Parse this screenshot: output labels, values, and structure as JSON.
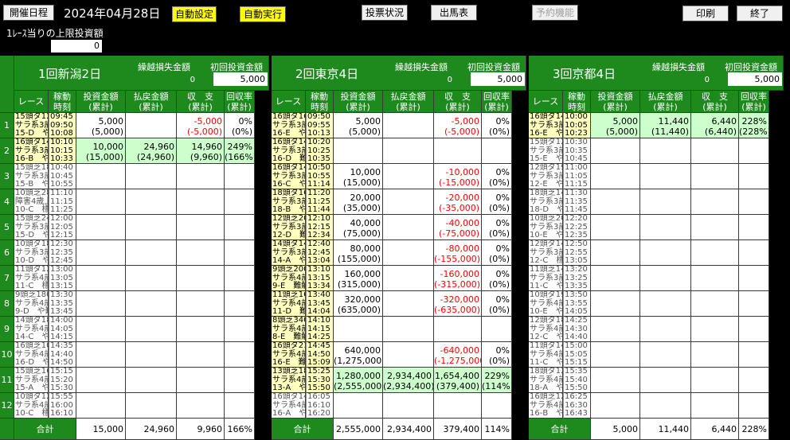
{
  "toolbar": {
    "schedule": "開催日程",
    "date": "2024年04月28日",
    "auto_setting": "自動設定",
    "auto_run": "自動実行",
    "vote_status": "投票状況",
    "entries": "出馬表",
    "reservation": "予約機能",
    "print": "印刷",
    "exit": "終了"
  },
  "limit": {
    "label": "1ﾚｰｽ当りの上限投資額",
    "value": "0"
  },
  "headers": {
    "race": "レース",
    "time": "稼動\n時刻",
    "invest": "投資金額\n(累計)",
    "payout": "払戻金額\n(累計)",
    "balance": "収　支\n(累計)",
    "rate": "回収率\n(累計)",
    "carry_label": "繰越損失金額",
    "first_label": "初回投資金額",
    "total": "合計"
  },
  "venues": [
    {
      "name": "1回新潟2日",
      "carry": "0",
      "first": "5,000",
      "rows": [
        {
          "race": "15頭ダ1200\nサラ系3歳\n15-D　や難",
          "time": "09:45\n09:50\n10:08",
          "hl": true,
          "dim": false,
          "invest": [
            "5,000",
            "(5,000)"
          ],
          "payout": [
            "",
            ""
          ],
          "balance": [
            "-5,000",
            "(-5,000)"
          ],
          "rate": [
            "0%",
            "(0%)"
          ],
          "green": false
        },
        {
          "race": "16頭ダ1400\nサラ系3歳\n16-B　や難",
          "time": "10:10\n10:15\n10:33",
          "hl": true,
          "dim": false,
          "invest": [
            "10,000",
            "(15,000)"
          ],
          "payout": [
            "24,960",
            "(24,960)"
          ],
          "balance": [
            "14,960",
            "(9,960)"
          ],
          "rate": [
            "249%",
            "(166%)"
          ],
          "green": true
        },
        {
          "race": "15頭芝1800\nサラ系3歳\n15-B　や難",
          "time": "10:40\n10:45\n10:55",
          "hl": false,
          "dim": true,
          "invest": [
            "",
            ""
          ],
          "payout": [
            "",
            ""
          ],
          "balance": [
            "",
            ""
          ],
          "rate": [
            "",
            ""
          ],
          "green": false
        },
        {
          "race": "10頭芝2890\n障害4歳上\n10-C　標準",
          "time": "11:10\n11:15\n11:25",
          "hl": false,
          "dim": true,
          "invest": [
            "",
            ""
          ],
          "payout": [
            "",
            ""
          ],
          "balance": [
            "",
            ""
          ],
          "rate": [
            "",
            ""
          ],
          "green": false
        },
        {
          "race": "15頭芝2400\nサラ系3歳\n15-D　や難",
          "time": "12:00\n12:05\n12:15",
          "hl": false,
          "dim": true,
          "invest": [
            "",
            ""
          ],
          "payout": [
            "",
            ""
          ],
          "balance": [
            "",
            ""
          ],
          "rate": [
            "",
            ""
          ],
          "green": false
        },
        {
          "race": "10頭ダ1800\nサラ系3歳\n10-D　や難",
          "time": "12:30\n12:35\n12:45",
          "hl": false,
          "dim": true,
          "invest": [
            "",
            ""
          ],
          "payout": [
            "",
            ""
          ],
          "balance": [
            "",
            ""
          ],
          "rate": [
            "",
            ""
          ],
          "green": false
        },
        {
          "race": "11頭ダ1200\nサラ系4歳上\n11-C　標準",
          "time": "13:00\n13:05\n13:15",
          "hl": false,
          "dim": true,
          "invest": [
            "",
            ""
          ],
          "payout": [
            "",
            ""
          ],
          "balance": [
            "",
            ""
          ],
          "rate": [
            "",
            ""
          ],
          "green": false
        },
        {
          "race": "9頭芝1800\nサラ系4歳上\n9-D　や難",
          "time": "13:30\n13:35\n13:45",
          "hl": false,
          "dim": true,
          "invest": [
            "",
            ""
          ],
          "payout": [
            "",
            ""
          ],
          "balance": [
            "",
            ""
          ],
          "rate": [
            "",
            ""
          ],
          "green": false
        },
        {
          "race": "14頭ダ1800\nサラ系4歳上\n14-C　や難",
          "time": "14:00\n14:05\n14:15",
          "hl": false,
          "dim": true,
          "invest": [
            "",
            ""
          ],
          "payout": [
            "",
            ""
          ],
          "balance": [
            "",
            ""
          ],
          "rate": [
            "",
            ""
          ],
          "green": false
        },
        {
          "race": "16頭芝1000\nサラ系4歳上\n16-D　や難",
          "time": "14:35\n14:40\n14:50",
          "hl": false,
          "dim": true,
          "invest": [
            "",
            ""
          ],
          "payout": [
            "",
            ""
          ],
          "balance": [
            "",
            ""
          ],
          "rate": [
            "",
            ""
          ],
          "green": false
        },
        {
          "race": "15頭芝1600\nサラ系4歳上\n15-A　や難",
          "time": "15:15\n15:20\n15:30",
          "hl": false,
          "dim": true,
          "invest": [
            "",
            ""
          ],
          "payout": [
            "",
            ""
          ],
          "balance": [
            "",
            ""
          ],
          "rate": [
            "",
            ""
          ],
          "green": false
        },
        {
          "race": "10頭ダ1200\nサラ系4歳上\n10-C　標準",
          "time": "15:55\n16:00\n16:10",
          "hl": false,
          "dim": true,
          "invest": [
            "",
            ""
          ],
          "payout": [
            "",
            ""
          ],
          "balance": [
            "",
            ""
          ],
          "rate": [
            "",
            ""
          ],
          "green": false
        }
      ],
      "totals": {
        "invest": "15,000",
        "payout": "24,960",
        "balance": "9,960",
        "rate": "166%"
      }
    },
    {
      "name": "2回東京4日",
      "carry": "0",
      "first": "5,000",
      "rows": [
        {
          "race": "16頭ダ1600\nサラ系3歳\n16-E　や難",
          "time": "09:50\n09:55\n10:13",
          "hl": true,
          "dim": false,
          "invest": [
            "5,000",
            "(5,000)"
          ],
          "payout": [
            "",
            ""
          ],
          "balance": [
            "-5,000",
            "(-5,000)"
          ],
          "rate": [
            "0%",
            "(0%)"
          ],
          "green": false
        },
        {
          "race": "16頭ダ1400\nサラ系3歳\n16-D　難解",
          "time": "10:20\n10:25\n10:35",
          "hl": true,
          "dim": false,
          "invest": [
            "",
            ""
          ],
          "payout": [
            "",
            ""
          ],
          "balance": [
            "",
            ""
          ],
          "rate": [
            "",
            ""
          ],
          "green": false
        },
        {
          "race": "16頭ダ1400\nサラ系3歳\n16-C　や難",
          "time": "10:50\n10:55\n11:14",
          "hl": true,
          "dim": false,
          "invest": [
            "10,000",
            "(15,000)"
          ],
          "payout": [
            "",
            ""
          ],
          "balance": [
            "-10,000",
            "(-15,000)"
          ],
          "rate": [
            "0%",
            "(0%)"
          ],
          "green": false
        },
        {
          "race": "18頭ダ1600\nサラ系3歳\n18-B　や難",
          "time": "11:20\n11:25\n11:44",
          "hl": true,
          "dim": false,
          "invest": [
            "20,000",
            "(35,000)"
          ],
          "payout": [
            "",
            ""
          ],
          "balance": [
            "-20,000",
            "(-35,000)"
          ],
          "rate": [
            "0%",
            "(0%)"
          ],
          "green": false
        },
        {
          "race": "12頭芝2000\nサラ系3歳\n12-D　難解",
          "time": "12:10\n12:15\n12:34",
          "hl": true,
          "dim": false,
          "invest": [
            "40,000",
            "(75,000)"
          ],
          "payout": [
            "",
            ""
          ],
          "balance": [
            "-40,000",
            "(-75,000)"
          ],
          "rate": [
            "0%",
            "(0%)"
          ],
          "green": false
        },
        {
          "race": "14頭ダ1400\nサラ系3歳\n14-A　や難",
          "time": "12:40\n12:45\n13:04",
          "hl": true,
          "dim": false,
          "invest": [
            "80,000",
            "(155,000)"
          ],
          "payout": [
            "",
            ""
          ],
          "balance": [
            "-80,000",
            "(-155,000)"
          ],
          "rate": [
            "0%",
            "(0%)"
          ],
          "green": false
        },
        {
          "race": "9頭芝2000\nサラ系4歳上\n9-E　難解",
          "time": "13:10\n13:15\n13:34",
          "hl": true,
          "dim": false,
          "invest": [
            "160,000",
            "(315,000)"
          ],
          "payout": [
            "",
            ""
          ],
          "balance": [
            "-160,000",
            "(-315,000)"
          ],
          "rate": [
            "0%",
            "(0%)"
          ],
          "green": false
        },
        {
          "race": "11頭芝1600\nサラ系4歳上\n11-D　難解",
          "time": "13:40\n13:45\n14:04",
          "hl": true,
          "dim": false,
          "invest": [
            "320,000",
            "(635,000)"
          ],
          "payout": [
            "",
            ""
          ],
          "balance": [
            "-320,000",
            "(-635,000)"
          ],
          "rate": [
            "0%",
            "(0%)"
          ],
          "green": false
        },
        {
          "race": "8頭芝3400\nサラ系4歳上\n8-E　難解",
          "time": "14:10\n14:15\n14:25",
          "hl": true,
          "dim": false,
          "invest": [
            "",
            ""
          ],
          "payout": [
            "",
            ""
          ],
          "balance": [
            "",
            ""
          ],
          "rate": [
            "",
            ""
          ],
          "green": false
        },
        {
          "race": "16頭ダ2100\nサラ系4歳上\n16-E　難解",
          "time": "14:45\n14:50\n15:09",
          "hl": true,
          "dim": false,
          "invest": [
            "640,000",
            "(1,275,000)"
          ],
          "payout": [
            "",
            ""
          ],
          "balance": [
            "-640,000",
            "(-1,275,000)"
          ],
          "rate": [
            "0%",
            "(0%)"
          ],
          "green": false
        },
        {
          "race": "13頭芝1800\nサラ系4歳上\n13-A　や難",
          "time": "15:25\n15:30\n15:50",
          "hl": true,
          "dim": false,
          "invest": [
            "1,280,000",
            "(2,555,000)"
          ],
          "payout": [
            "2,934,400",
            "(2,934,400)"
          ],
          "balance": [
            "1,654,400",
            "(379,400)"
          ],
          "rate": [
            "229%",
            "(114%)"
          ],
          "green": true
        },
        {
          "race": "16頭ダ1400\nサラ系4歳上\n16-A　や難",
          "time": "16:05\n16:10\n16:20",
          "hl": false,
          "dim": true,
          "invest": [
            "",
            ""
          ],
          "payout": [
            "",
            ""
          ],
          "balance": [
            "",
            ""
          ],
          "rate": [
            "",
            ""
          ],
          "green": false
        }
      ],
      "totals": {
        "invest": "2,555,000",
        "payout": "2,934,400",
        "balance": "379,400",
        "rate": "114%"
      }
    },
    {
      "name": "3回京都4日",
      "carry": "0",
      "first": "5,000",
      "rows": [
        {
          "race": "16頭ダ1400\nサラ系3歳\n16-E　や難",
          "time": "10:00\n10:05\n10:23",
          "hl": true,
          "dim": false,
          "invest": [
            "5,000",
            "(5,000)"
          ],
          "payout": [
            "11,440",
            "(11,440)"
          ],
          "balance": [
            "6,440",
            "(6,440)"
          ],
          "rate": [
            "228%",
            "(228%)"
          ],
          "green": true
        },
        {
          "race": "15頭ダ1200\nサラ系3歳\n15-E　や難",
          "time": "10:30\n10:35\n10:45",
          "hl": false,
          "dim": true,
          "invest": [
            "",
            ""
          ],
          "payout": [
            "",
            ""
          ],
          "balance": [
            "",
            ""
          ],
          "rate": [
            "",
            ""
          ],
          "green": false
        },
        {
          "race": "12頭ダ1900\nサラ系3歳\n12-E　や難",
          "time": "11:00\n11:05\n11:15",
          "hl": false,
          "dim": true,
          "invest": [
            "",
            ""
          ],
          "payout": [
            "",
            ""
          ],
          "balance": [
            "",
            ""
          ],
          "rate": [
            "",
            ""
          ],
          "green": false
        },
        {
          "race": "18頭芝1400\nサラ系3歳\n18-D　や難",
          "time": "11:30\n11:35\n11:45",
          "hl": false,
          "dim": true,
          "invest": [
            "",
            ""
          ],
          "payout": [
            "",
            ""
          ],
          "balance": [
            "",
            ""
          ],
          "rate": [
            "",
            ""
          ],
          "green": false
        },
        {
          "race": "10頭芝2000\nサラ系3歳\n10-E　や難",
          "time": "12:20\n12:25\n12:35",
          "hl": false,
          "dim": true,
          "invest": [
            "",
            ""
          ],
          "payout": [
            "",
            ""
          ],
          "balance": [
            "",
            ""
          ],
          "rate": [
            "",
            ""
          ],
          "green": false
        },
        {
          "race": "12頭ダ1400\nサラ系3歳\n12-C　標準",
          "time": "12:50\n12:55\n13:05",
          "hl": false,
          "dim": true,
          "invest": [
            "",
            ""
          ],
          "payout": [
            "",
            ""
          ],
          "balance": [
            "",
            ""
          ],
          "rate": [
            "",
            ""
          ],
          "green": false
        },
        {
          "race": "11頭芝1400\nサラ系3歳\n11-C　や難",
          "time": "13:20\n13:25\n13:35",
          "hl": false,
          "dim": true,
          "invest": [
            "",
            ""
          ],
          "payout": [
            "",
            ""
          ],
          "balance": [
            "",
            ""
          ],
          "rate": [
            "",
            ""
          ],
          "green": false
        },
        {
          "race": "10頭ダ1900\nサラ系4歳上\n10-E　や難",
          "time": "13:50\n13:55\n14:05",
          "hl": false,
          "dim": true,
          "invest": [
            "",
            ""
          ],
          "payout": [
            "",
            ""
          ],
          "balance": [
            "",
            ""
          ],
          "rate": [
            "",
            ""
          ],
          "green": false
        },
        {
          "race": "12頭ダ1800\nサラ系4歳上\n12-C　や難",
          "time": "14:25\n14:30\n14:40",
          "hl": false,
          "dim": true,
          "invest": [
            "",
            ""
          ],
          "payout": [
            "",
            ""
          ],
          "balance": [
            "",
            ""
          ],
          "rate": [
            "",
            ""
          ],
          "green": false
        },
        {
          "race": "11頭ダ1400\nサラ系4歳上\n11-C　や難",
          "time": "15:00\n15:05\n15:15",
          "hl": false,
          "dim": true,
          "invest": [
            "",
            ""
          ],
          "payout": [
            "",
            ""
          ],
          "balance": [
            "",
            ""
          ],
          "rate": [
            "",
            ""
          ],
          "green": false
        },
        {
          "race": "18頭ダ1200\nサラ系4歳上\n18-A　や難",
          "time": "15:35\n15:40\n15:50",
          "hl": false,
          "dim": true,
          "invest": [
            "",
            ""
          ],
          "payout": [
            "",
            ""
          ],
          "balance": [
            "",
            ""
          ],
          "rate": [
            "",
            ""
          ],
          "green": false
        },
        {
          "race": "16頭芝1200\nサラ系4歳上\n16-B　や難",
          "time": "16:25\n16:30\n16:43",
          "hl": false,
          "dim": true,
          "invest": [
            "",
            ""
          ],
          "payout": [
            "",
            ""
          ],
          "balance": [
            "",
            ""
          ],
          "rate": [
            "",
            ""
          ],
          "green": false
        }
      ],
      "totals": {
        "invest": "5,000",
        "payout": "11,440",
        "balance": "6,440",
        "rate": "228%"
      }
    }
  ]
}
